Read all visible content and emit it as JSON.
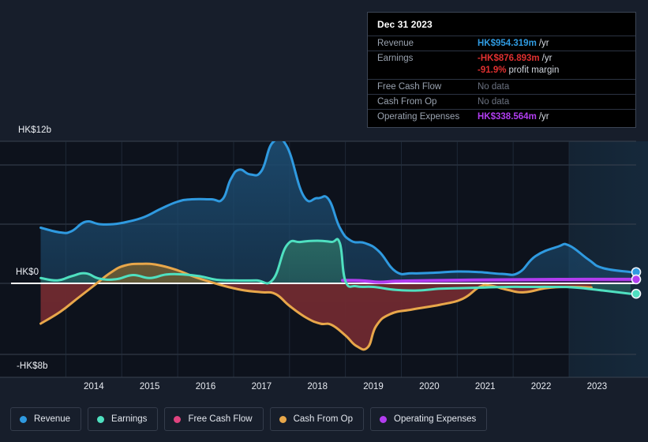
{
  "tooltip": {
    "date": "Dec 31 2023",
    "rows": [
      {
        "key": "Revenue",
        "value": "HK$954.319m",
        "unit": "/yr",
        "color": "#2f9ae0",
        "nodata": false
      },
      {
        "key": "Earnings",
        "value": "-HK$876.893m",
        "unit": "/yr",
        "color": "#e03030",
        "nodata": false
      },
      {
        "key": "",
        "value": "-91.9%",
        "unit": "profit margin",
        "color": "#e03030",
        "nodata": false,
        "sub": true
      },
      {
        "key": "Free Cash Flow",
        "value": "No data",
        "unit": "",
        "color": "#6b7280",
        "nodata": true
      },
      {
        "key": "Cash From Op",
        "value": "No data",
        "unit": "",
        "color": "#6b7280",
        "nodata": true
      },
      {
        "key": "Operating Expenses",
        "value": "HK$338.564m",
        "unit": "/yr",
        "color": "#b23df0",
        "nodata": false
      }
    ]
  },
  "legend": {
    "items": [
      {
        "label": "Revenue",
        "color": "#2f9ae0"
      },
      {
        "label": "Earnings",
        "color": "#4fe0c0"
      },
      {
        "label": "Free Cash Flow",
        "color": "#e0437f"
      },
      {
        "label": "Cash From Op",
        "color": "#e8a74a"
      },
      {
        "label": "Operating Expenses",
        "color": "#b23df0"
      }
    ]
  },
  "chart_data": {
    "type": "area",
    "title": "",
    "xlabel": "",
    "ylabel": "",
    "currency": "HK$",
    "ylim": [
      -8000000000,
      12000000000
    ],
    "y_ticks": [
      {
        "label": "HK$12b",
        "value": 12000000000
      },
      {
        "label": "HK$0",
        "value": 0
      },
      {
        "label": "-HK$8b",
        "value": -8000000000
      }
    ],
    "grid": true,
    "gridlines_y": [
      12,
      10,
      5,
      0,
      -6
    ],
    "zero_line": true,
    "legend_position": "bottom",
    "x_ticks": [
      "2014",
      "2015",
      "2016",
      "2017",
      "2018",
      "2019",
      "2020",
      "2021",
      "2022",
      "2023"
    ],
    "x_range": [
      "2013.5",
      "2024.2"
    ],
    "forecast_shading_from": "2023.0",
    "series": [
      {
        "name": "Revenue",
        "color": "#2f9ae0",
        "fill": "#1c4a6e",
        "unit": "b",
        "points": [
          [
            2013.55,
            4.7
          ],
          [
            2013.9,
            4.3
          ],
          [
            2014.1,
            4.4
          ],
          [
            2014.35,
            5.2
          ],
          [
            2014.6,
            5.0
          ],
          [
            2014.85,
            5.0
          ],
          [
            2015.1,
            5.2
          ],
          [
            2015.4,
            5.6
          ],
          [
            2015.7,
            6.3
          ],
          [
            2016.0,
            6.9
          ],
          [
            2016.25,
            7.1
          ],
          [
            2016.6,
            7.1
          ],
          [
            2016.8,
            7.1
          ],
          [
            2016.95,
            8.8
          ],
          [
            2017.1,
            9.6
          ],
          [
            2017.3,
            9.2
          ],
          [
            2017.5,
            9.5
          ],
          [
            2017.7,
            11.9
          ],
          [
            2017.95,
            11.6
          ],
          [
            2018.25,
            7.4
          ],
          [
            2018.5,
            7.2
          ],
          [
            2018.7,
            7.1
          ],
          [
            2018.9,
            4.7
          ],
          [
            2019.1,
            3.6
          ],
          [
            2019.35,
            3.4
          ],
          [
            2019.6,
            2.7
          ],
          [
            2019.9,
            1.0
          ],
          [
            2020.2,
            0.85
          ],
          [
            2020.6,
            0.9
          ],
          [
            2021.0,
            1.0
          ],
          [
            2021.4,
            0.95
          ],
          [
            2021.8,
            0.8
          ],
          [
            2022.1,
            0.9
          ],
          [
            2022.4,
            2.3
          ],
          [
            2022.8,
            3.1
          ],
          [
            2023.0,
            3.2
          ],
          [
            2023.35,
            2.0
          ],
          [
            2023.6,
            1.3
          ],
          [
            2024.1,
            0.95
          ]
        ],
        "last_value": "HK$954.319m"
      },
      {
        "name": "Earnings",
        "color": "#4fe0c0",
        "fill": "#2a6a62",
        "unit": "b",
        "points": [
          [
            2013.55,
            0.45
          ],
          [
            2013.85,
            0.25
          ],
          [
            2014.1,
            0.6
          ],
          [
            2014.35,
            0.85
          ],
          [
            2014.6,
            0.4
          ],
          [
            2014.9,
            0.35
          ],
          [
            2015.2,
            0.7
          ],
          [
            2015.5,
            0.45
          ],
          [
            2015.8,
            0.75
          ],
          [
            2016.1,
            0.75
          ],
          [
            2016.4,
            0.6
          ],
          [
            2016.7,
            0.3
          ],
          [
            2017.0,
            0.25
          ],
          [
            2017.4,
            0.25
          ],
          [
            2017.7,
            0.3
          ],
          [
            2017.95,
            3.2
          ],
          [
            2018.2,
            3.5
          ],
          [
            2018.5,
            3.6
          ],
          [
            2018.75,
            3.5
          ],
          [
            2018.9,
            3.4
          ],
          [
            2019.0,
            0.2
          ],
          [
            2019.2,
            -0.25
          ],
          [
            2019.5,
            -0.3
          ],
          [
            2019.9,
            -0.55
          ],
          [
            2020.3,
            -0.6
          ],
          [
            2020.7,
            -0.45
          ],
          [
            2021.1,
            -0.4
          ],
          [
            2021.5,
            -0.35
          ],
          [
            2021.9,
            -0.3
          ],
          [
            2022.3,
            -0.3
          ],
          [
            2022.7,
            -0.3
          ],
          [
            2023.1,
            -0.35
          ],
          [
            2023.6,
            -0.6
          ],
          [
            2024.1,
            -0.88
          ]
        ],
        "last_value": "-HK$876.893m"
      },
      {
        "name": "Free Cash Flow",
        "color": "#e0437f",
        "fill": "#6e2a44",
        "unit": "b",
        "points": [],
        "last_value": "No data"
      },
      {
        "name": "Cash From Op",
        "color": "#e8a74a",
        "fill": "#6b5a33",
        "unit": "b",
        "points": [
          [
            2013.55,
            -3.4
          ],
          [
            2013.9,
            -2.4
          ],
          [
            2014.2,
            -1.3
          ],
          [
            2014.5,
            -0.2
          ],
          [
            2014.8,
            0.9
          ],
          [
            2015.05,
            1.5
          ],
          [
            2015.35,
            1.65
          ],
          [
            2015.65,
            1.55
          ],
          [
            2016.0,
            1.1
          ],
          [
            2016.3,
            0.55
          ],
          [
            2016.6,
            0.1
          ],
          [
            2016.9,
            -0.3
          ],
          [
            2017.2,
            -0.6
          ],
          [
            2017.5,
            -0.75
          ],
          [
            2017.75,
            -0.9
          ],
          [
            2018.0,
            -1.9
          ],
          [
            2018.3,
            -2.9
          ],
          [
            2018.55,
            -3.4
          ],
          [
            2018.75,
            -3.5
          ],
          [
            2019.0,
            -4.4
          ],
          [
            2019.2,
            -5.3
          ],
          [
            2019.4,
            -5.4
          ],
          [
            2019.55,
            -3.6
          ],
          [
            2019.8,
            -2.6
          ],
          [
            2020.2,
            -2.2
          ],
          [
            2020.7,
            -1.8
          ],
          [
            2021.1,
            -1.3
          ],
          [
            2021.4,
            -0.3
          ],
          [
            2021.6,
            -0.2
          ],
          [
            2021.9,
            -0.55
          ],
          [
            2022.2,
            -0.75
          ],
          [
            2022.6,
            -0.4
          ],
          [
            2023.0,
            -0.3
          ],
          [
            2023.4,
            -0.35
          ]
        ],
        "last_value": "No data"
      },
      {
        "name": "Operating Expenses",
        "color": "#b23df0",
        "fill": "#4a1d63",
        "unit": "b",
        "points": [
          [
            2018.95,
            0.25
          ],
          [
            2019.3,
            0.22
          ],
          [
            2019.6,
            0.1
          ],
          [
            2019.9,
            0.18
          ],
          [
            2020.3,
            0.22
          ],
          [
            2020.8,
            0.25
          ],
          [
            2021.3,
            0.28
          ],
          [
            2021.8,
            0.3
          ],
          [
            2022.3,
            0.32
          ],
          [
            2022.8,
            0.33
          ],
          [
            2023.3,
            0.34
          ],
          [
            2024.1,
            0.338
          ]
        ],
        "last_value": "HK$338.564m"
      }
    ],
    "endpoints": [
      {
        "name": "Revenue",
        "color": "#2f9ae0",
        "y": 0.95
      },
      {
        "name": "Operating Expenses",
        "color": "#b23df0",
        "y": 0.338
      },
      {
        "name": "Earnings",
        "color": "#4fe0c0",
        "y": -0.877
      }
    ]
  }
}
